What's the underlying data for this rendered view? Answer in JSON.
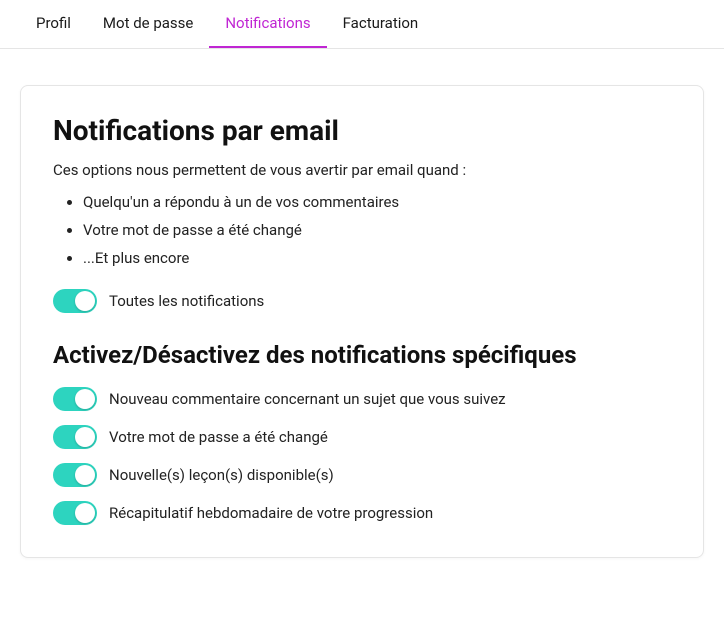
{
  "tabs": [
    {
      "label": "Profil",
      "active": false
    },
    {
      "label": "Mot de passe",
      "active": false
    },
    {
      "label": "Notifications",
      "active": true
    },
    {
      "label": "Facturation",
      "active": false
    }
  ],
  "emailNotifications": {
    "heading": "Notifications par email",
    "intro": "Ces options nous permettent de vous avertir par email quand :",
    "bullets": [
      "Quelqu'un a répondu à un de vos commentaires",
      "Votre mot de passe a été changé",
      "...Et plus encore"
    ],
    "allToggle": {
      "label": "Toutes les notifications",
      "on": true
    }
  },
  "specific": {
    "heading": "Activez/Désactivez des notifications spécifiques",
    "items": [
      {
        "label": "Nouveau commentaire concernant un sujet que vous suivez",
        "on": true
      },
      {
        "label": "Votre mot de passe a été changé",
        "on": true
      },
      {
        "label": "Nouvelle(s) leçon(s) disponible(s)",
        "on": true
      },
      {
        "label": "Récapitulatif hebdomadaire de votre progression",
        "on": true
      }
    ]
  }
}
